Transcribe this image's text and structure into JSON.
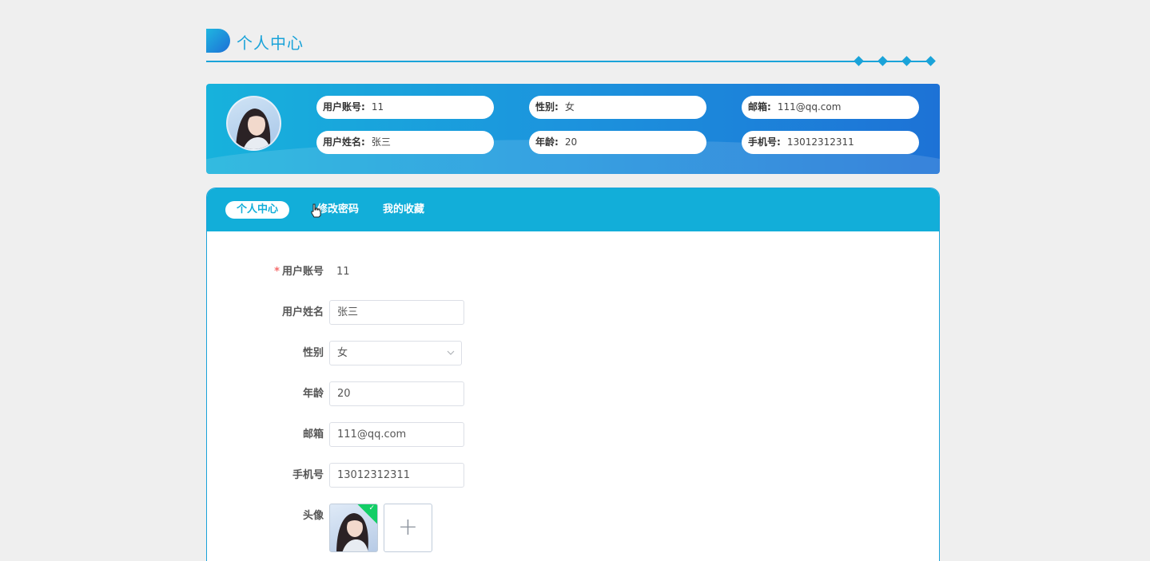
{
  "header": {
    "title": "个人中心"
  },
  "banner": {
    "fields": [
      {
        "label": "用户账号:",
        "value": "11"
      },
      {
        "label": "性别:",
        "value": "女"
      },
      {
        "label": "邮箱:",
        "value": "111@qq.com"
      },
      {
        "label": "用户姓名:",
        "value": "张三"
      },
      {
        "label": "年龄:",
        "value": "20"
      },
      {
        "label": "手机号:",
        "value": "13012312311"
      }
    ]
  },
  "tabs": [
    {
      "label": "个人中心",
      "active": true
    },
    {
      "label": "修改密码",
      "active": false
    },
    {
      "label": "我的收藏",
      "active": false
    }
  ],
  "form": {
    "account": {
      "label": "用户账号",
      "required": "*",
      "value": "11"
    },
    "name": {
      "label": "用户姓名",
      "value": "张三"
    },
    "gender": {
      "label": "性别",
      "value": "女"
    },
    "age": {
      "label": "年龄",
      "value": "20"
    },
    "email": {
      "label": "邮箱",
      "value": "111@qq.com"
    },
    "phone": {
      "label": "手机号",
      "value": "13012312311"
    },
    "avatar": {
      "label": "头像",
      "add_symbol": "+",
      "check_symbol": "✓"
    }
  },
  "colors": {
    "accent": "#1aa3d9",
    "tab_bar": "#12aed9",
    "success": "#13ce66",
    "required": "#f56c6c"
  },
  "icons": {
    "title_icon": "d-shape-icon",
    "select_arrow": "chevron-down-icon",
    "cursor": "hand-pointer-icon"
  }
}
